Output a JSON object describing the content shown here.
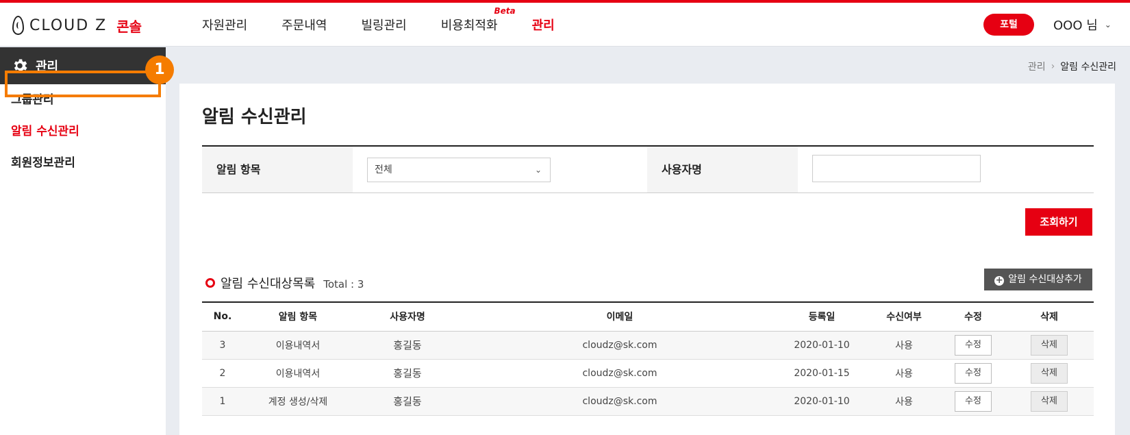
{
  "header": {
    "logo_text": "CLOUD Z",
    "logo_sub": "콘솔",
    "nav": [
      {
        "label": "자원관리"
      },
      {
        "label": "주문내역"
      },
      {
        "label": "빌링관리"
      },
      {
        "label": "비용최적화",
        "badge": "Beta"
      },
      {
        "label": "관리"
      }
    ],
    "portal_label": "포털",
    "user_label": "OOO 님"
  },
  "sidebar": {
    "title": "관리",
    "items": [
      {
        "label": "그룹관리"
      },
      {
        "label": "알림 수신관리"
      },
      {
        "label": "회원정보관리"
      }
    ],
    "step_badge": "1"
  },
  "breadcrumb": {
    "parent": "관리",
    "current": "알림 수신관리"
  },
  "page": {
    "title": "알림 수신관리"
  },
  "search": {
    "category_label": "알림 항목",
    "category_value": "전체",
    "user_label": "사용자명",
    "user_value": "",
    "submit_label": "조회하기"
  },
  "list": {
    "title": "알림 수신대상목록",
    "total": "Total : 3",
    "add_label": "알림 수신대상추가",
    "columns": [
      "No.",
      "알림 항목",
      "사용자명",
      "이메일",
      "등록일",
      "수신여부",
      "수정",
      "삭제"
    ],
    "rows": [
      {
        "no": "3",
        "category": "이용내역서",
        "user": "홍길동",
        "email": "cloudz@sk.com",
        "date": "2020-01-10",
        "status": "사용"
      },
      {
        "no": "2",
        "category": "이용내역서",
        "user": "홍길동",
        "email": "cloudz@sk.com",
        "date": "2020-01-15",
        "status": "사용"
      },
      {
        "no": "1",
        "category": "계정 생성/삭제",
        "user": "홍길동",
        "email": "cloudz@sk.com",
        "date": "2020-01-10",
        "status": "사용"
      }
    ],
    "edit_label": "수정",
    "delete_label": "삭제"
  },
  "colors": {
    "accent": "#e60012",
    "highlight": "#f57c00",
    "sidebar_head": "#333333"
  }
}
